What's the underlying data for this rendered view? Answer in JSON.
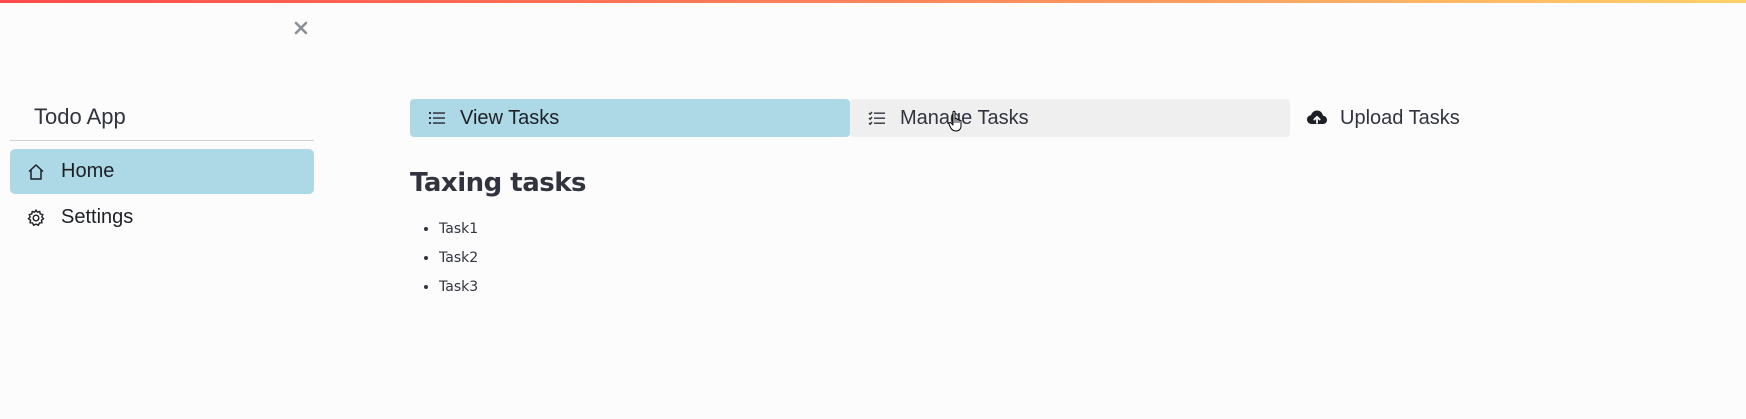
{
  "sidebar": {
    "title": "Todo App",
    "close_icon": "close-icon",
    "items": [
      {
        "label": "Home",
        "icon": "home-icon",
        "active": true
      },
      {
        "label": "Settings",
        "icon": "gear-icon",
        "active": false
      }
    ]
  },
  "tabs": [
    {
      "label": "View Tasks",
      "icon": "list-icon",
      "state": "active"
    },
    {
      "label": "Manage Tasks",
      "icon": "checklist-icon",
      "state": "hovered"
    },
    {
      "label": "Upload Tasks",
      "icon": "cloud-upload-icon",
      "state": "normal"
    }
  ],
  "content": {
    "heading": "Taxing tasks",
    "tasks": [
      "Task1",
      "Task2",
      "Task3"
    ]
  },
  "colors": {
    "active_bg": "#add8e6",
    "hover_bg": "#efefef",
    "text": "#31333f",
    "accent_gradient_start": "#ff4b4b",
    "accent_gradient_end": "#ffd16a"
  }
}
